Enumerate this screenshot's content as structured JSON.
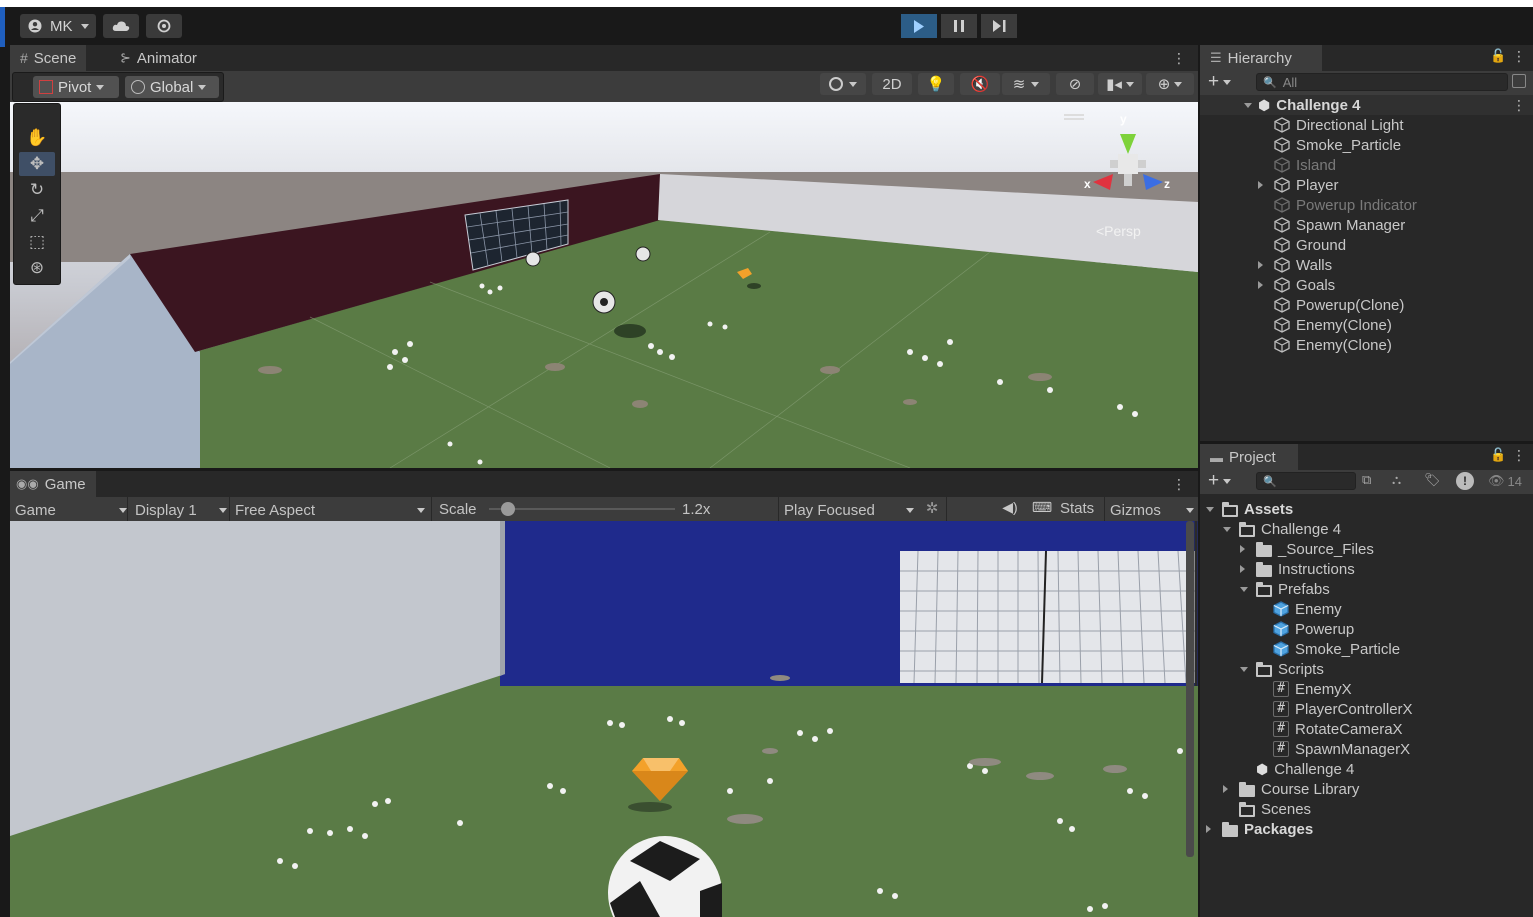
{
  "toolbar": {
    "account_label": "MK",
    "account_icon": "account-icon",
    "cloud_icon": "cloud-icon",
    "collab_icon": "collab-icon",
    "play_icon": "play-icon",
    "pause_icon": "pause-icon",
    "step_icon": "step-icon"
  },
  "scene_panel": {
    "tabs": [
      {
        "label": "Scene",
        "icon": "grid-icon"
      },
      {
        "label": "Animator",
        "icon": "animator-icon"
      }
    ],
    "pivot_label": "Pivot",
    "global_label": "Global",
    "mode_2d_label": "2D",
    "persp_label": "<Persp",
    "gizmo_axes": {
      "x": "x",
      "y": "y",
      "z": "z"
    }
  },
  "game_panel": {
    "tab_label": "Game",
    "game_dropdown": "Game",
    "display_dropdown": "Display 1",
    "aspect_dropdown": "Free Aspect",
    "scale_label": "Scale",
    "scale_value": "1.2x",
    "scale_fraction": 0.0,
    "play_focused_label": "Play Focused",
    "stats_label": "Stats",
    "gizmos_label": "Gizmos"
  },
  "hierarchy": {
    "tab_label": "Hierarchy",
    "search_placeholder": "All",
    "root": "Challenge 4",
    "items": [
      {
        "label": "Directional Light",
        "dim": false,
        "expandable": false
      },
      {
        "label": "Smoke_Particle",
        "dim": false,
        "expandable": false
      },
      {
        "label": "Island",
        "dim": true,
        "expandable": false
      },
      {
        "label": "Player",
        "dim": false,
        "expandable": true
      },
      {
        "label": "Powerup Indicator",
        "dim": true,
        "expandable": false
      },
      {
        "label": "Spawn Manager",
        "dim": false,
        "expandable": false
      },
      {
        "label": "Ground",
        "dim": false,
        "expandable": false
      },
      {
        "label": "Walls",
        "dim": false,
        "expandable": true
      },
      {
        "label": "Goals",
        "dim": false,
        "expandable": true
      },
      {
        "label": "Powerup(Clone)",
        "dim": false,
        "expandable": false
      },
      {
        "label": "Enemy(Clone)",
        "dim": false,
        "expandable": false
      },
      {
        "label": "Enemy(Clone)",
        "dim": false,
        "expandable": false
      }
    ]
  },
  "project": {
    "tab_label": "Project",
    "hidden_count": "14",
    "tree": [
      {
        "label": "Assets",
        "type": "folder-open",
        "depth": 0,
        "bold": true
      },
      {
        "label": "Challenge 4",
        "type": "folder-open",
        "depth": 1
      },
      {
        "label": "_Source_Files",
        "type": "folder",
        "depth": 2,
        "arrow": true
      },
      {
        "label": "Instructions",
        "type": "folder",
        "depth": 2,
        "arrow": true
      },
      {
        "label": "Prefabs",
        "type": "folder-open",
        "depth": 2,
        "open": true
      },
      {
        "label": "Enemy",
        "type": "prefab",
        "depth": 3
      },
      {
        "label": "Powerup",
        "type": "prefab",
        "depth": 3
      },
      {
        "label": "Smoke_Particle",
        "type": "prefab",
        "depth": 3
      },
      {
        "label": "Scripts",
        "type": "folder-open",
        "depth": 2,
        "open": true
      },
      {
        "label": "EnemyX",
        "type": "script",
        "depth": 3
      },
      {
        "label": "PlayerControllerX",
        "type": "script",
        "depth": 3
      },
      {
        "label": "RotateCameraX",
        "type": "script",
        "depth": 3
      },
      {
        "label": "SpawnManagerX",
        "type": "script",
        "depth": 3
      },
      {
        "label": "Challenge 4",
        "type": "scene",
        "depth": 2
      },
      {
        "label": "Course Library",
        "type": "folder",
        "depth": 1,
        "arrow": true
      },
      {
        "label": "Scenes",
        "type": "folder-empty",
        "depth": 1
      },
      {
        "label": "Packages",
        "type": "folder",
        "depth": 0,
        "arrow": true,
        "bold": true
      }
    ]
  },
  "colors": {
    "accent": "#2c5d87",
    "panel_bg": "#282828",
    "toolbar_bg": "#3c3c3c",
    "sky": "#1f2a8c",
    "grass": "#5b7a45",
    "prefab_blue": "#4fa3e0",
    "powerup_orange": "#f3a12a",
    "wall_maroon": "#3b1520"
  }
}
